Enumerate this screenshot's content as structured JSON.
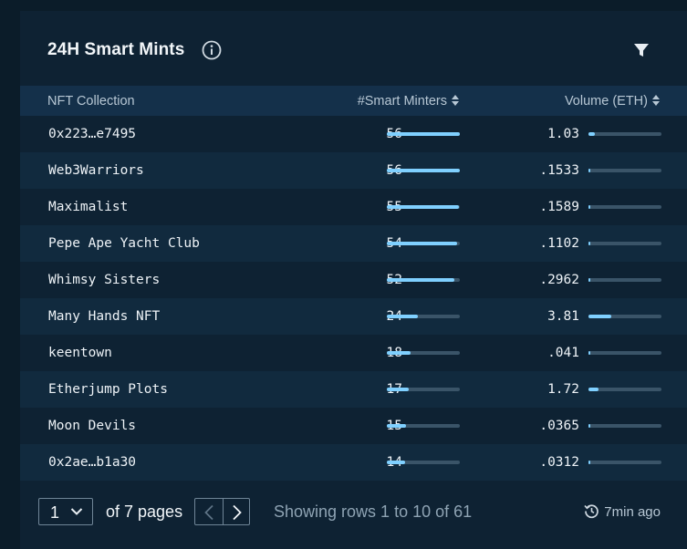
{
  "widget": {
    "title": "24H Smart Mints",
    "info_icon": "info-icon",
    "filter_icon": "filter-icon"
  },
  "table": {
    "columns": [
      {
        "label": "NFT Collection"
      },
      {
        "label": "#Smart Minters",
        "sortable": true
      },
      {
        "label": "Volume (ETH)",
        "sortable": true
      }
    ],
    "rows": [
      {
        "name": "0x223…e7495",
        "smart_minters": "56",
        "volume": "1.03"
      },
      {
        "name": "Web3Warriors",
        "smart_minters": "56",
        "volume": ".1533"
      },
      {
        "name": "Maximalist",
        "smart_minters": "55",
        "volume": ".1589"
      },
      {
        "name": "Pepe Ape Yacht Club",
        "smart_minters": "54",
        "volume": ".1102"
      },
      {
        "name": "Whimsy Sisters",
        "smart_minters": "52",
        "volume": ".2962"
      },
      {
        "name": "Many Hands NFT",
        "smart_minters": "24",
        "volume": "3.81"
      },
      {
        "name": "keentown",
        "smart_minters": "18",
        "volume": ".041"
      },
      {
        "name": "Etherjump Plots",
        "smart_minters": "17",
        "volume": "1.72"
      },
      {
        "name": "Moon Devils",
        "smart_minters": "15",
        "volume": ".0365"
      },
      {
        "name": "0x2ae…b1a30",
        "smart_minters": "14",
        "volume": ".0312"
      }
    ],
    "minters_max": 56,
    "volume_max": 12
  },
  "footer": {
    "current_page": "1",
    "of_pages": "of 7 pages",
    "showing": "Showing rows 1 to 10 of 61",
    "updated": "7min ago"
  },
  "colors": {
    "background": "#0e2233",
    "header_bg": "#14304a",
    "bar_fill": "#7fd0ff",
    "bar_track": "#3a5468"
  }
}
